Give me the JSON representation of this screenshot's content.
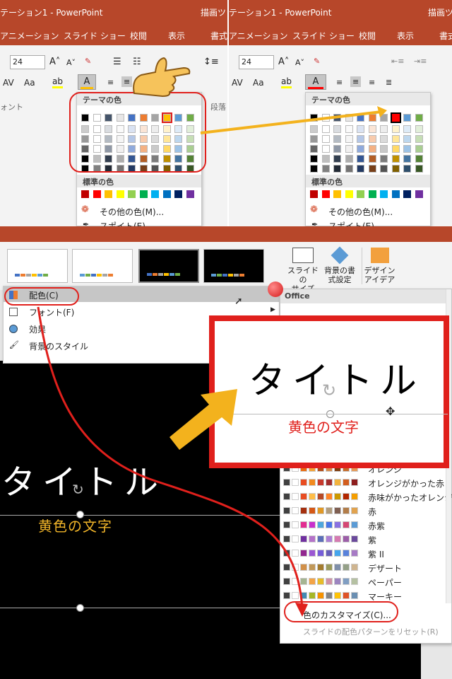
{
  "top": {
    "title_left": "テーション1 - PowerPoint",
    "title_right_left": "描画ツ",
    "title_mid": "テーション1 - PowerPoint",
    "title_right": "描画ツ",
    "tabs_left": [
      "アニメーション",
      "スライド ショー",
      "校閲",
      "表示",
      "書式"
    ],
    "tabs_right": [
      "アニメーション",
      "スライド ショー",
      "校閲",
      "表示",
      "書式"
    ],
    "font_size": "24",
    "font_group": "ォント",
    "para_group": "段落",
    "theme_header": "テーマの色",
    "std_header": "標準の色",
    "more_colors": "その他の色(M)...",
    "eyedropper": "スポイト(E)",
    "theme_top": [
      "#000000",
      "#ffffff",
      "#44546a",
      "#e7e6e6",
      "#4472c4",
      "#ed7d31",
      "#a5a5a5",
      "#ffc000",
      "#5b9bd5",
      "#70ad47"
    ],
    "standard": [
      "#c00000",
      "#ff0000",
      "#ffc000",
      "#ffff00",
      "#92d050",
      "#00b050",
      "#00b0f0",
      "#0070c0",
      "#002060",
      "#7030a0"
    ]
  },
  "bottom": {
    "launch_slide": "スライドの",
    "launch_size": "サイズ",
    "launch_bg1": "背景の書",
    "launch_bg2": "式設定",
    "launch_di1": "デザイン",
    "launch_di2": "アイデア",
    "menu": [
      "配色(C)",
      "フォント(F)",
      "効果",
      "背景のスタイル"
    ],
    "office": "Office",
    "schemes": [
      {
        "name": "オレンジ",
        "c": [
          "#ea6b0f",
          "#f4a234",
          "#b24b16",
          "#d78a4b",
          "#7d3b0e",
          "#c46b2a",
          "#e69a57"
        ]
      },
      {
        "name": "オレンジがかった赤",
        "c": [
          "#e84c22",
          "#f28a1f",
          "#c7392c",
          "#a22d2d",
          "#f2b33d",
          "#d25d1e",
          "#8e1e1e"
        ]
      },
      {
        "name": "赤味がかったオレンジ",
        "c": [
          "#e84c22",
          "#ffbd47",
          "#b64926",
          "#ff8427",
          "#cc9900",
          "#b22600",
          "#f59e00"
        ]
      },
      {
        "name": "赤",
        "c": [
          "#a5300f",
          "#d55816",
          "#e19825",
          "#b19c7d",
          "#7f5f52",
          "#b27d49",
          "#e1a34f"
        ]
      },
      {
        "name": "赤紫",
        "c": [
          "#e32d91",
          "#c830cc",
          "#4ea6dc",
          "#4775e7",
          "#8971e1",
          "#d54773",
          "#5b9bd5"
        ]
      },
      {
        "name": "紫",
        "c": [
          "#7030a0",
          "#b472c9",
          "#5b6fb8",
          "#ac7fd5",
          "#d67ab1",
          "#9c5ea8",
          "#6b4a9c"
        ]
      },
      {
        "name": "紫 II",
        "c": [
          "#92278f",
          "#9b57d3",
          "#755dd9",
          "#665eb8",
          "#45a5ed",
          "#5982db",
          "#a77ac5"
        ]
      },
      {
        "name": "デザート",
        "c": [
          "#d19049",
          "#c19859",
          "#a37b2e",
          "#9a9a5c",
          "#7f8fa9",
          "#94a088",
          "#cfb590"
        ]
      },
      {
        "name": "ペーパー",
        "c": [
          "#a5b592",
          "#f3a447",
          "#e7bc29",
          "#d092a7",
          "#9c85c0",
          "#809ec2",
          "#b5c1a2"
        ]
      },
      {
        "name": "マーキー",
        "c": [
          "#418ab3",
          "#a6b727",
          "#f69200",
          "#838383",
          "#fec306",
          "#df5327",
          "#6a8fb2"
        ]
      }
    ],
    "customize": "色のカスタマイズ(C)...",
    "reset": "スライドの配色パターンをリセット(R)",
    "slide_title": "タイトル",
    "slide_sub": "黄色の文字",
    "zoom_title": "タイトル",
    "zoom_sub": "黄色の文字"
  }
}
